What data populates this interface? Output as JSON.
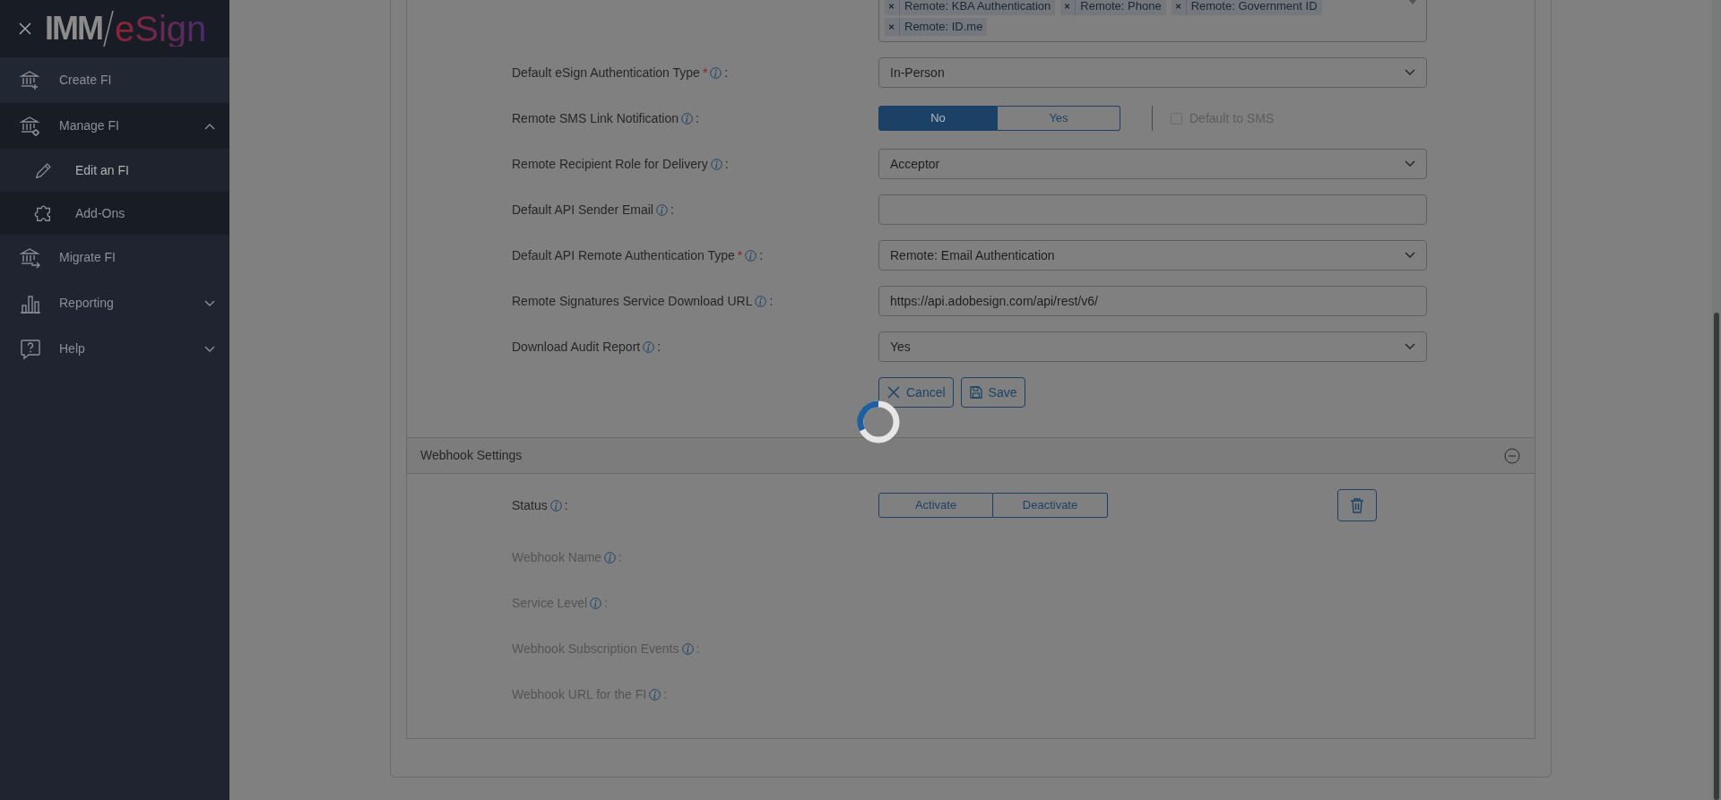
{
  "sidebar": {
    "logo": {
      "left": "IMM",
      "right": "eSign"
    },
    "items": [
      {
        "kind": "link",
        "label": "Create FI"
      },
      {
        "kind": "group",
        "label": "Manage FI",
        "expanded": true,
        "children": [
          {
            "label": "Edit an FI",
            "selected": true
          },
          {
            "label": "Add-Ons",
            "selected": false
          }
        ]
      },
      {
        "kind": "link",
        "label": "Migrate FI"
      },
      {
        "kind": "group",
        "label": "Reporting",
        "expanded": false
      },
      {
        "kind": "group",
        "label": "Help",
        "expanded": false
      }
    ]
  },
  "form": {
    "rows": [
      {
        "kind": "tags",
        "tags": [
          "Remote: KBA Authentication",
          "Remote: Phone",
          "Remote: Government ID",
          "Remote: ID.me"
        ]
      },
      {
        "kind": "select",
        "label": "Default eSign Authentication Type",
        "required": "*",
        "suffix": ":",
        "value": "In-Person"
      },
      {
        "kind": "toggle",
        "label": "Remote SMS Link Notification",
        "suffix": ":",
        "options": [
          {
            "label": "No",
            "selected": true
          },
          {
            "label": "Yes",
            "selected": false
          }
        ],
        "checkbox": {
          "label": "Default to SMS",
          "checked": false,
          "disabled": true
        }
      },
      {
        "kind": "select",
        "label": "Remote Recipient Role for Delivery",
        "suffix": ":",
        "value": "Acceptor"
      },
      {
        "kind": "text",
        "label": "Default API Sender Email",
        "suffix": ":"
      },
      {
        "kind": "select",
        "label": "Default API Remote Authentication Type",
        "required": "*",
        "suffix": ":",
        "value": "Remote: Email Authentication"
      },
      {
        "kind": "text",
        "label": "Remote Signatures Service Download URL",
        "suffix": ":",
        "value": "https://api.adobesign.com/api/rest/v6/"
      },
      {
        "kind": "select",
        "label": "Download Audit Report",
        "suffix": ":",
        "value": "Yes"
      }
    ],
    "buttons": [
      {
        "kind": "cancel",
        "label": "Cancel"
      },
      {
        "kind": "save",
        "label": "Save"
      }
    ]
  },
  "webhook": {
    "title": "Webhook Settings",
    "expanded": true,
    "fields": [
      {
        "label": "Status",
        "suffix": ":",
        "disabled": false,
        "options": [
          {
            "label": "Activate",
            "selected": false
          },
          {
            "label": "Deactivate",
            "selected": false
          }
        ]
      },
      {
        "label": "Webhook Name",
        "suffix": ":",
        "disabled": true
      },
      {
        "label": "Service Level",
        "suffix": ":",
        "disabled": true
      },
      {
        "label": "Webhook Subscription Events",
        "suffix": ":",
        "disabled": true
      },
      {
        "label": "Webhook URL for the FI",
        "suffix": ":",
        "disabled": true
      }
    ]
  }
}
